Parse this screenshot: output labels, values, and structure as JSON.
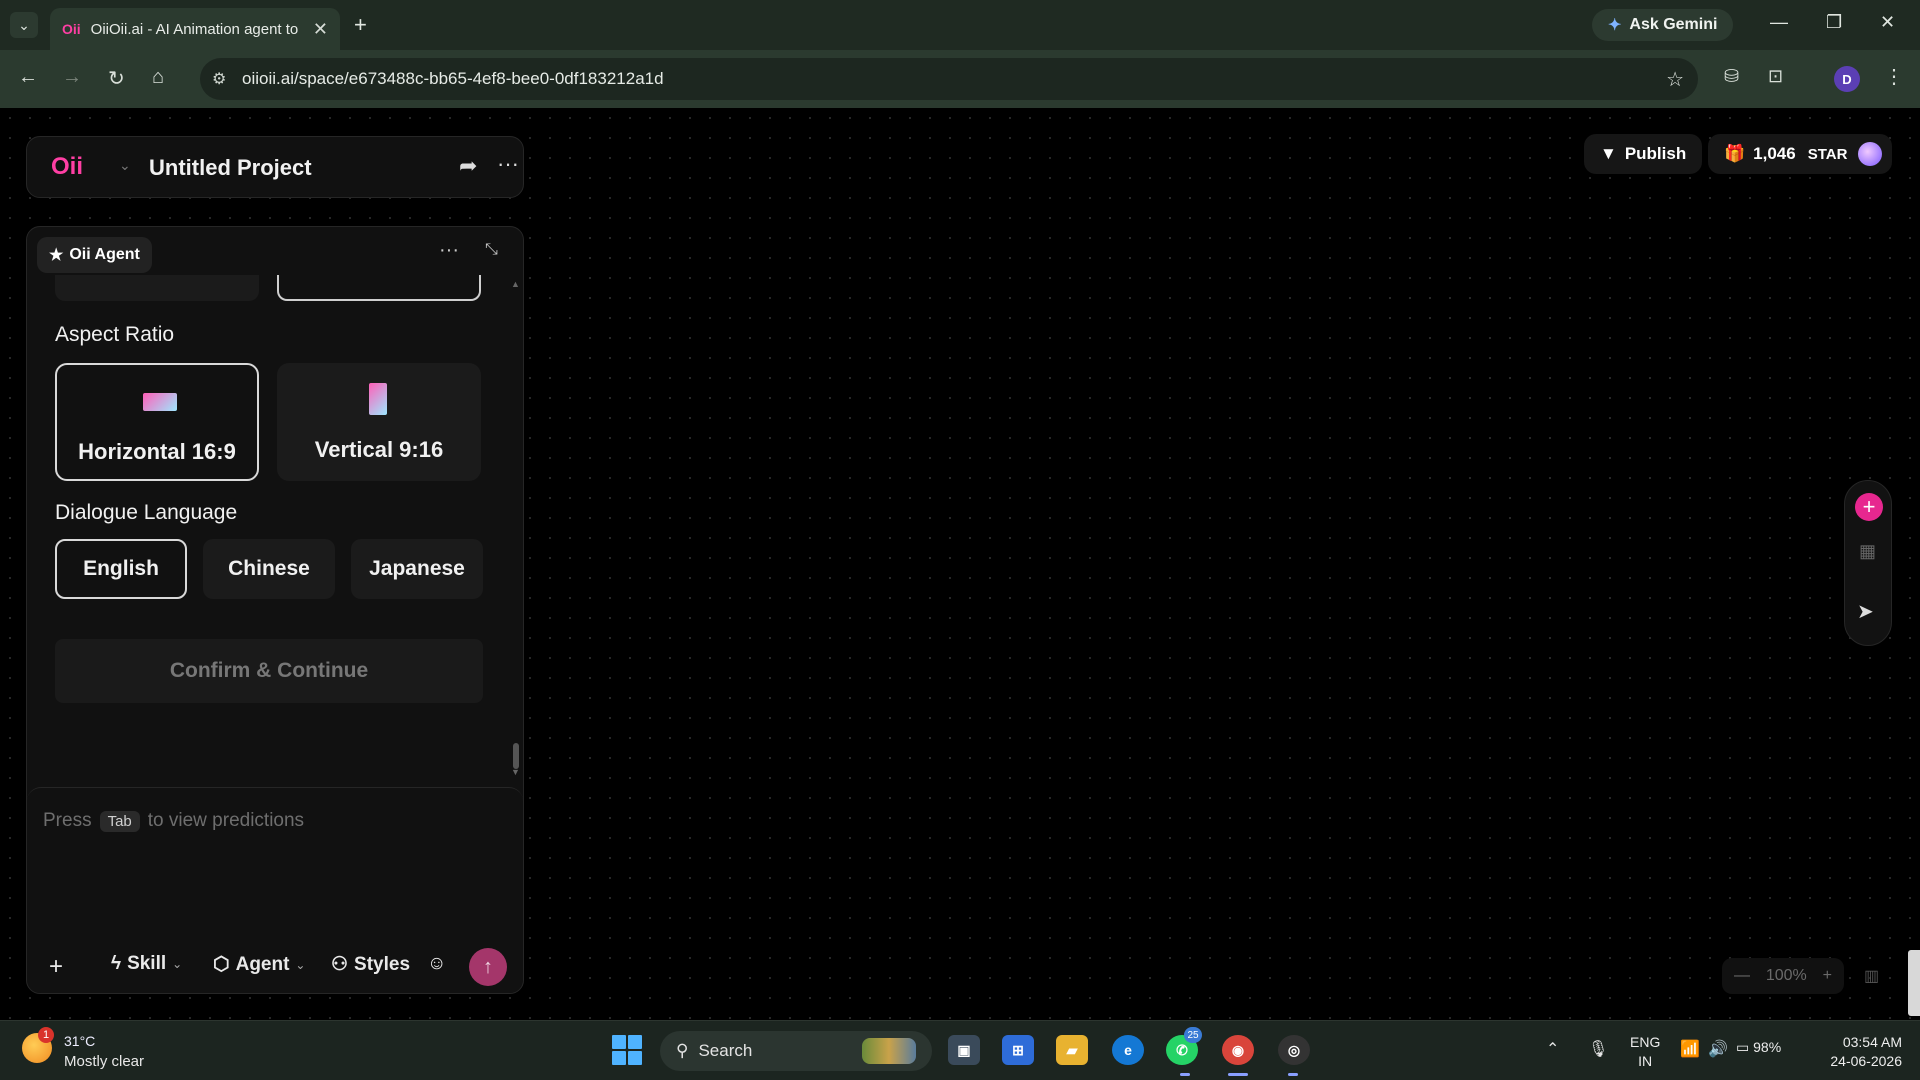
{
  "browser": {
    "tab_title": "OiiOii.ai - AI Animation agent to",
    "tab_favicon": "Oii",
    "ask_gemini": "Ask Gemini",
    "url": "oiioii.ai/space/e673488c-bb65-4ef8-bee0-0df183212a1d",
    "profile_initial": "D"
  },
  "project": {
    "logo": "Oii",
    "name": "Untitled Project"
  },
  "top_right": {
    "publish_label": "Publish",
    "credits": "1,046",
    "credits_unit": "STAR"
  },
  "agent": {
    "chip_label": "Oii Agent",
    "aspect_ratio_heading": "Aspect Ratio",
    "aspect_options": [
      {
        "label": "Horizontal 16:9",
        "selected": true
      },
      {
        "label": "Vertical 9:16",
        "selected": false
      }
    ],
    "language_heading": "Dialogue Language",
    "language_options": [
      {
        "label": "English",
        "selected": true
      },
      {
        "label": "Chinese",
        "selected": false
      },
      {
        "label": "Japanese",
        "selected": false
      }
    ],
    "confirm_label": "Confirm & Continue",
    "input": {
      "press": "Press",
      "key": "Tab",
      "rest": "to view predictions"
    },
    "toolbar": {
      "skill": "Skill",
      "agent": "Agent",
      "styles": "Styles"
    }
  },
  "canvas": {
    "zoom": "100%"
  },
  "taskbar": {
    "temperature": "31°C",
    "weather": "Mostly clear",
    "weather_badge": "1",
    "search_label": "Search",
    "whatsapp_badge": "25",
    "lang_line1": "ENG",
    "lang_line2": "IN",
    "battery": "98%",
    "time": "03:54 AM",
    "date": "24-06-2026"
  },
  "colors": {
    "accent_pink": "#e7278f",
    "send_button": "#a4366a",
    "browser_chrome": "#2b3a2f"
  }
}
